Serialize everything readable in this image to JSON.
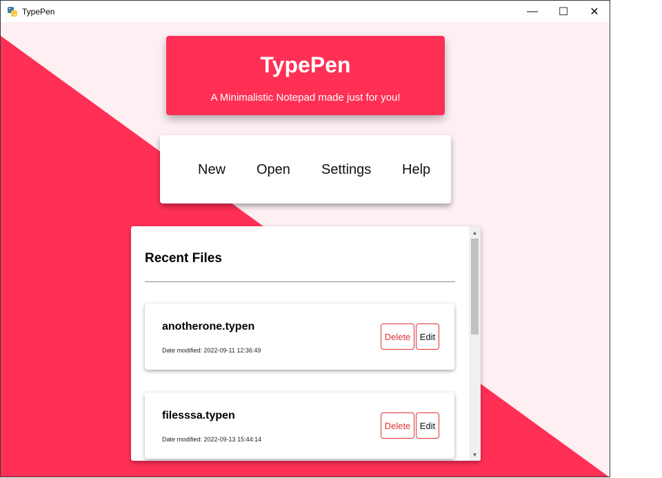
{
  "window": {
    "title": "TypePen",
    "minimize_glyph": "—",
    "maximize_glyph": "☐",
    "close_glyph": "✕"
  },
  "colors": {
    "accent": "#ff2f55",
    "background_light": "#fdeff2",
    "danger": "#e03030"
  },
  "header": {
    "title": "TypePen",
    "subtitle": "A Minimalistic Notepad made just for you!"
  },
  "menu": {
    "new": "New",
    "open": "Open",
    "settings": "Settings",
    "help": "Help"
  },
  "recent": {
    "heading": "Recent Files",
    "files": [
      {
        "name": "anotherone.typen",
        "date": "Date modified: 2022-09-11 12:36:49",
        "delete_label": "Delete",
        "edit_label": "Edit"
      },
      {
        "name": "filesssa.typen",
        "date": "Date modified: 2022-09-13 15:44:14",
        "delete_label": "Delete",
        "edit_label": "Edit"
      }
    ]
  },
  "scrollbar": {
    "up_glyph": "▲",
    "down_glyph": "▼"
  }
}
